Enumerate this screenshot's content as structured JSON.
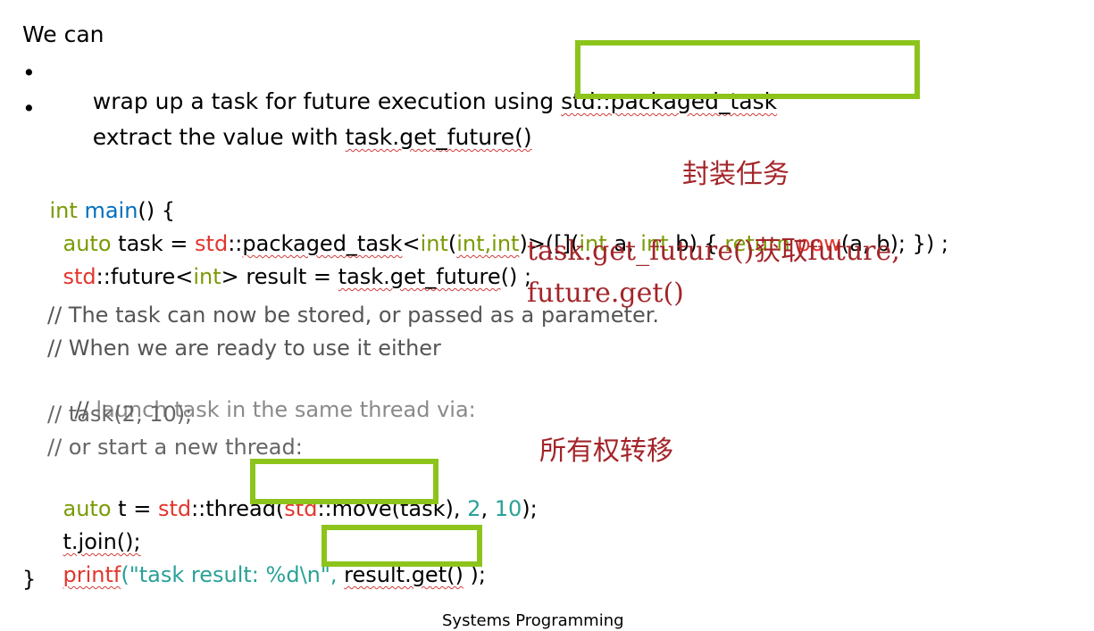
{
  "intro": "We can",
  "bullets": [
    {
      "marker": "•",
      "text_a": "wrap up a task for future execution using ",
      "code": "std::packaged_task"
    },
    {
      "marker": "•",
      "text_a": "extract the value with ",
      "code": "task.get_future()"
    }
  ],
  "code_lines": {
    "l1_int": "int",
    "l1_main": "main",
    "l1_rest": "() {",
    "l2_auto": "auto",
    "l2_task": " task = ",
    "l2_std": "std",
    "l2_sep1": "::",
    "l2_pkg": "packaged_task",
    "l2_lt": "<",
    "l2_int1": "int",
    "l2_paren": "(",
    "l2_int2int3": "int,int",
    "l2_mid": ")>([](",
    "l2_int4": "int",
    "l2_a": " a, ",
    "l2_int5": "int",
    "l2_b": " b) { ",
    "l2_return": "return",
    "l2_sp": " ",
    "l2_pow": "pow",
    "l2_end": "(a, b); }) ;",
    "l3_std": "std",
    "l3_future": "::future<",
    "l3_int": "int",
    "l3_result": "> result = ",
    "l3_getfuture": "task.get_future",
    "l3_end": "() ;",
    "c1": "// The task can now be stored, or passed as a parameter.",
    "c2": "// When we are ready to use it either",
    "c3_slash": "//",
    "c3_rest": " launch task in the same thread via:",
    "c4": "// task(2, 10);",
    "c5": "// or start a new thread:",
    "l4_auto": "auto",
    "l4_t": " t = ",
    "l4_std": "std",
    "l4_thread": "::thread(",
    "l4_std2": "std",
    "l4_move": "::move(task)",
    "l4_comma": ", ",
    "l4_2": "2",
    "l4_comma2": ", ",
    "l4_10": "10",
    "l4_end": ");",
    "l5": "t.join();",
    "l6_printf": "printf",
    "l6_str": "(\"task result: %d\\n\",",
    "l6_sp": " ",
    "l6_result": "result.get()",
    "l6_end": " );",
    "l7": "}"
  },
  "annotations": {
    "wrap_task": "封装任务",
    "get_future_line1": "task.get_future()获取future,",
    "get_future_line2": "future.get()",
    "ownership": "所有权转移"
  },
  "footer": "Systems Programming",
  "colors": {
    "highlight_box": "#8dc41c",
    "annotation": "#a3252a",
    "keyword_green": "#7a9a06",
    "keyword_red": "#e2362d",
    "function_blue": "#0070c0",
    "number_teal": "#2aa198"
  }
}
